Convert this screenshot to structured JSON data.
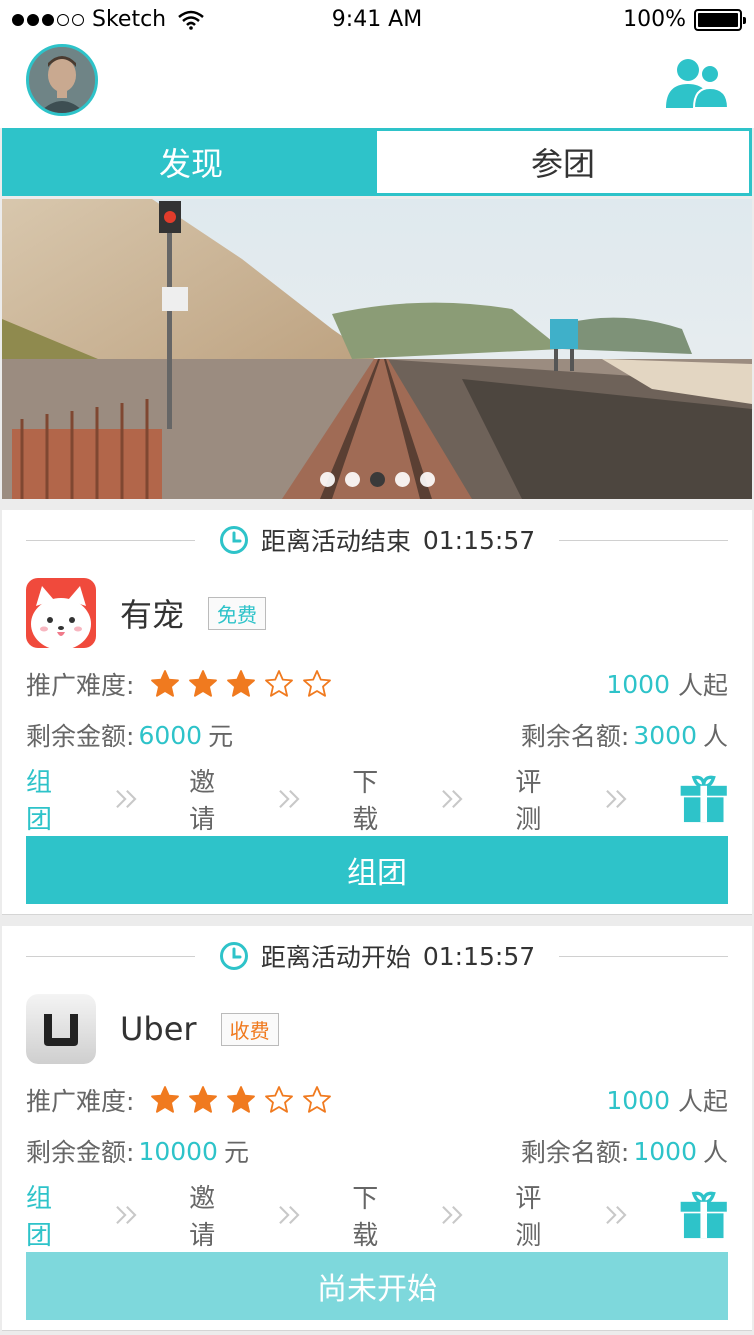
{
  "status_bar": {
    "carrier": "Sketch",
    "time": "9:41 AM",
    "battery": "100%"
  },
  "tabs": [
    {
      "label": "发现",
      "active": true
    },
    {
      "label": "参团",
      "active": false
    }
  ],
  "banner": {
    "slides": 5,
    "active_slide": 3
  },
  "cards": [
    {
      "timer_label": "距离活动结束",
      "timer_value": "01:15:57",
      "app_name": "有宠",
      "tag": "免费",
      "difficulty_label": "推广难度:",
      "difficulty_stars": 3,
      "difficulty_max": 5,
      "min_people": "1000",
      "min_people_unit": "人起",
      "amount_label": "剩余金额:",
      "amount_value": "6000",
      "amount_unit": "元",
      "quota_label": "剩余名额:",
      "quota_value": "3000",
      "quota_unit": "人",
      "steps": [
        "组团",
        "邀请",
        "下载",
        "评测"
      ],
      "button_label": "组团"
    },
    {
      "timer_label": "距离活动开始",
      "timer_value": "01:15:57",
      "app_name": "Uber",
      "tag": "收费",
      "difficulty_label": "推广难度:",
      "difficulty_stars": 3,
      "difficulty_max": 5,
      "min_people": "1000",
      "min_people_unit": "人起",
      "amount_label": "剩余金额:",
      "amount_value": "10000",
      "amount_unit": "元",
      "quota_label": "剩余名额:",
      "quota_value": "1000",
      "quota_unit": "人",
      "steps": [
        "组团",
        "邀请",
        "下载",
        "评测"
      ],
      "button_label": "尚未开始"
    }
  ],
  "colors": {
    "accent": "#2ec3c9",
    "star": "#f07a1f",
    "paid_tag": "#f07a1f"
  }
}
